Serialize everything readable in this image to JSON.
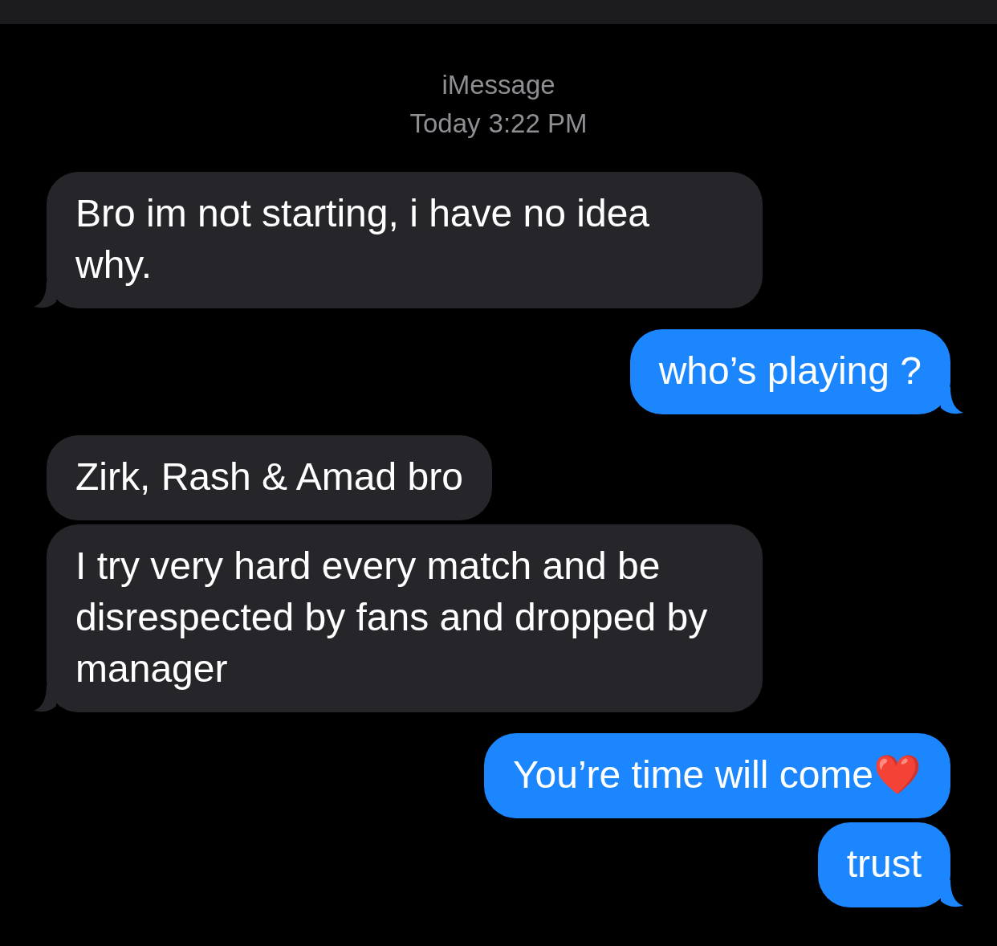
{
  "header": {
    "service": "iMessage",
    "day": "Today",
    "time": "3:22 PM"
  },
  "messages": [
    {
      "kind": "received",
      "text": "Bro im not starting, i have no idea why.",
      "tail": true
    },
    {
      "kind": "sent",
      "text": "who’s playing ?",
      "tail": true
    },
    {
      "kind": "received",
      "text": "Zirk, Rash & Amad bro",
      "tail": false
    },
    {
      "kind": "received",
      "text": "I try very hard every match and be disrespected by fans and dropped by manager",
      "tail": true
    },
    {
      "kind": "sent",
      "text": "You’re time will come❤️",
      "tail": false
    },
    {
      "kind": "sent",
      "text": "trust",
      "tail": true
    }
  ]
}
